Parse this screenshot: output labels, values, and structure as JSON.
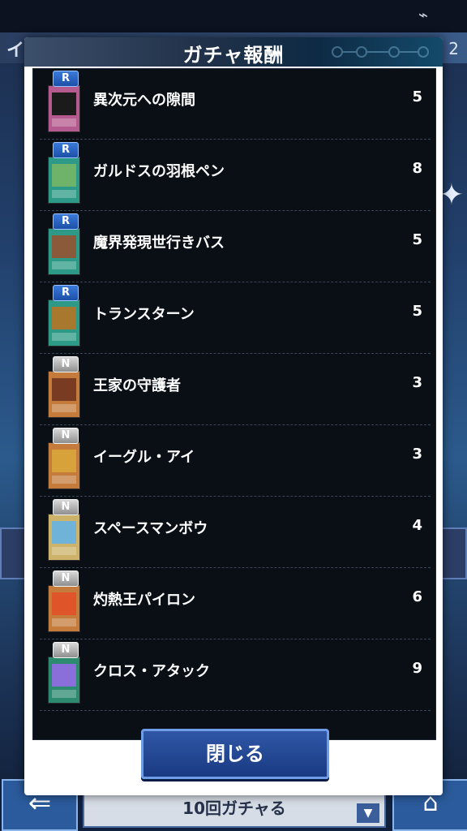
{
  "background": {
    "title": "イベ",
    "page_number": "2",
    "gacha_button_label": "10回ガチャる"
  },
  "modal": {
    "title": "ガチャ報酬",
    "close_label": "閉じる"
  },
  "rewards": [
    {
      "rarity": "R",
      "name": "異次元への隙間",
      "count": "5",
      "card_color": "#b45a8e",
      "art_color": "#1b1b1b"
    },
    {
      "rarity": "R",
      "name": "ガルドスの羽根ペン",
      "count": "8",
      "card_color": "#2c9a86",
      "art_color": "#6fb36a"
    },
    {
      "rarity": "R",
      "name": "魔界発現世行きバス",
      "count": "5",
      "card_color": "#2c9a86",
      "art_color": "#8a5a3a"
    },
    {
      "rarity": "R",
      "name": "トランスターン",
      "count": "5",
      "card_color": "#2c9a86",
      "art_color": "#a8782e"
    },
    {
      "rarity": "N",
      "name": "王家の守護者",
      "count": "3",
      "card_color": "#c47b3c",
      "art_color": "#7a3b23"
    },
    {
      "rarity": "N",
      "name": "イーグル・アイ",
      "count": "3",
      "card_color": "#c47b3c",
      "art_color": "#d8a23a"
    },
    {
      "rarity": "N",
      "name": "スペースマンボウ",
      "count": "4",
      "card_color": "#cdb36a",
      "art_color": "#6fb3d9"
    },
    {
      "rarity": "N",
      "name": "灼熱王パイロン",
      "count": "6",
      "card_color": "#c47b3c",
      "art_color": "#e0542a"
    },
    {
      "rarity": "N",
      "name": "クロス・アタック",
      "count": "9",
      "card_color": "#2c8a6f",
      "art_color": "#8a6ed9"
    }
  ]
}
